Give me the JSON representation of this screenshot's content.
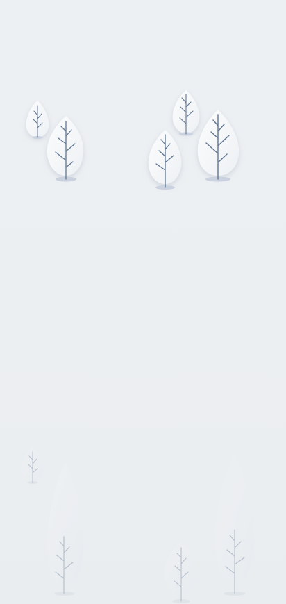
{
  "scene": {
    "description_visible_text": [],
    "colors": {
      "background": "#eceff2",
      "foliage": "#f6f7f9",
      "foliage_shadow": "#dfe3e8",
      "trunk": "#5f7591",
      "ground_shadow": "#c9d2de"
    },
    "icons": {
      "tree": "tree-icon"
    }
  }
}
